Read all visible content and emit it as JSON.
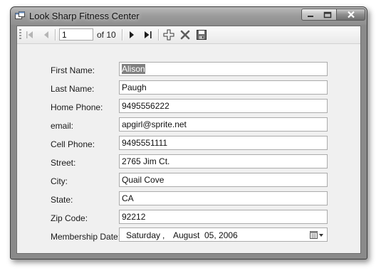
{
  "window": {
    "title": "Look Sharp Fitness Center",
    "app_icon": "form-window-icon"
  },
  "caption_buttons": {
    "minimize": "minimize-icon",
    "maximize": "maximize-icon",
    "close": "close-icon"
  },
  "navigator": {
    "position": "1",
    "count_label": "of 10",
    "icons": [
      "move-first-icon",
      "move-previous-icon",
      "move-next-icon",
      "move-last-icon",
      "add-new-icon",
      "delete-icon",
      "save-icon"
    ]
  },
  "form": {
    "fields": [
      {
        "key": "first_name",
        "label": "First Name:",
        "value": "Alison",
        "selected": true
      },
      {
        "key": "last_name",
        "label": "Last Name:",
        "value": "Paugh"
      },
      {
        "key": "home_phone",
        "label": "Home Phone:",
        "value": "9495556222"
      },
      {
        "key": "email",
        "label": "email:",
        "value": "apgirl@sprite.net"
      },
      {
        "key": "cell_phone",
        "label": "Cell Phone:",
        "value": "9495551111"
      },
      {
        "key": "street",
        "label": "Street:",
        "value": "2765 Jim Ct."
      },
      {
        "key": "city",
        "label": "City:",
        "value": "Quail Cove"
      },
      {
        "key": "state",
        "label": "State:",
        "value": "CA"
      },
      {
        "key": "zip",
        "label": "Zip Code:",
        "value": "92212"
      }
    ],
    "membership_date": {
      "label": "Membership Date:",
      "weekday": "Saturday",
      "separator": ",",
      "month": "August",
      "day_year": "05, 2006"
    }
  }
}
